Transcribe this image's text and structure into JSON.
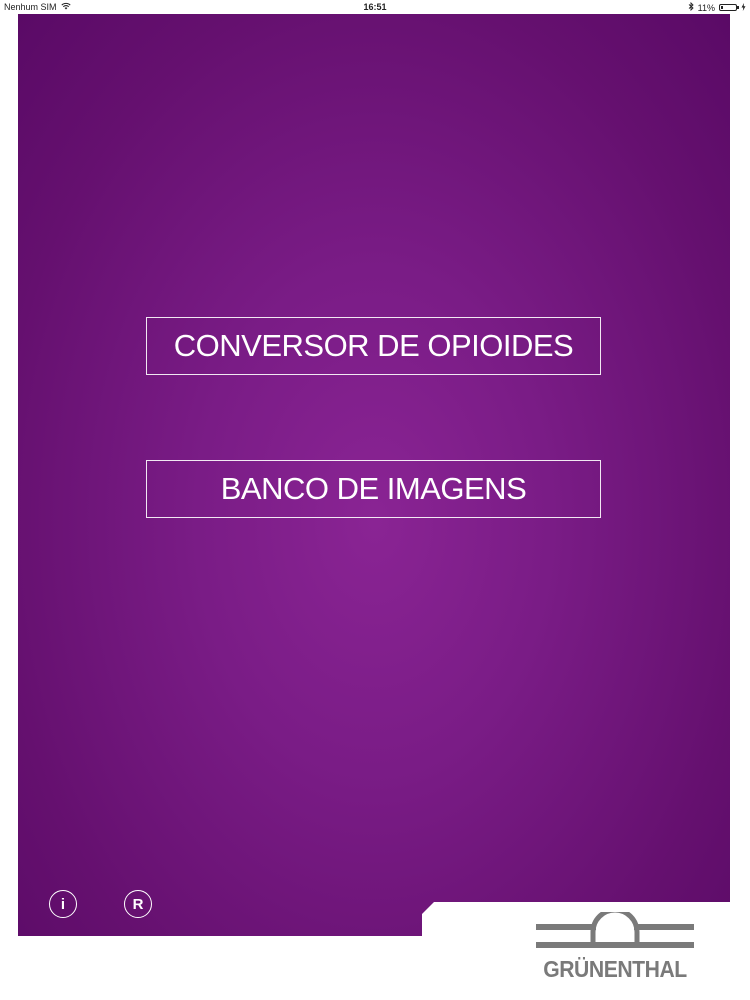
{
  "status_bar": {
    "carrier": "Nenhum SIM",
    "time": "16:51",
    "battery": "11%"
  },
  "menu": {
    "opioid_converter": "CONVERSOR DE OPIOIDES",
    "image_bank": "BANCO DE IMAGENS"
  },
  "footer": {
    "info_label": "i",
    "register_label": "R"
  },
  "logo": {
    "text": "GRÜNENTHAL",
    "color": "#7a7a7a"
  },
  "colors": {
    "accent": "#7a1c86",
    "panel_dark": "#5a0a66"
  }
}
